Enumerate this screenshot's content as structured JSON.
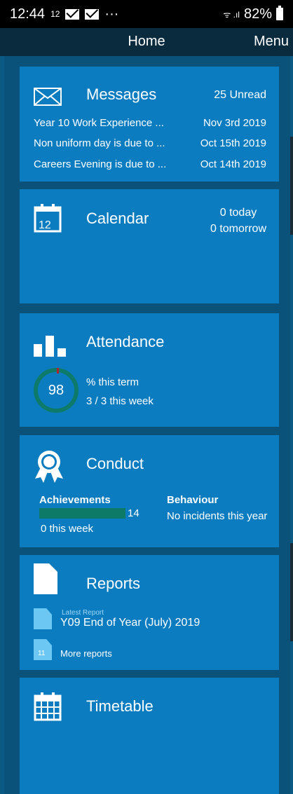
{
  "statusbar": {
    "time": "12:44",
    "notif_count": "12",
    "dots": "···",
    "signal": "ᯤ .ıl",
    "battery": "82%"
  },
  "navbar": {
    "title": "Home",
    "menu": "Menu"
  },
  "messages": {
    "title": "Messages",
    "unread": "25 Unread",
    "items": [
      {
        "subject": "Year 10 Work Experience ...",
        "date": "Nov 3rd 2019"
      },
      {
        "subject": "Non uniform day is due to ...",
        "date": "Oct 15th 2019"
      },
      {
        "subject": "Careers Evening is due to ...",
        "date": "Oct 14th 2019"
      }
    ]
  },
  "calendar": {
    "title": "Calendar",
    "icon_day": "12",
    "today": "0 today",
    "tomorrow": "0 tomorrow"
  },
  "attendance": {
    "title": "Attendance",
    "percent": "98",
    "term_label": "% this term",
    "week": "3 / 3 this week"
  },
  "conduct": {
    "title": "Conduct",
    "achievements_label": "Achievements",
    "achievements_value": "14",
    "achievements_week": "0 this week",
    "behaviour_label": "Behaviour",
    "behaviour_value": "No incidents this year"
  },
  "reports": {
    "title": "Reports",
    "latest_label": "Latest Report",
    "latest_name": "Y09 End of Year (July) 2019",
    "more_count": "11",
    "more_label": "More reports"
  },
  "timetable": {
    "title": "Timetable"
  },
  "colors": {
    "background": "#0b5a83",
    "card": "#0b7cc0",
    "navbar": "#0a2b3e",
    "attendance_ring": "#0d7a6a",
    "achievement_bar": "#0c7a66"
  }
}
